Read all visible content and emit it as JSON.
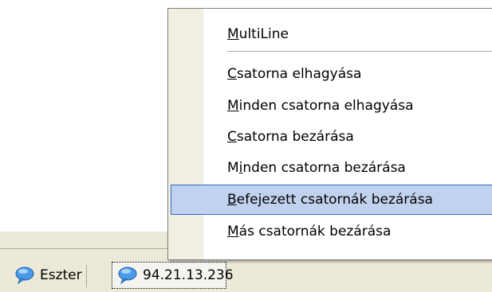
{
  "menu": {
    "items": [
      {
        "mnemonic": "M",
        "rest": "ultiLine"
      },
      {
        "mnemonic": "C",
        "rest": "satorna elhagyása"
      },
      {
        "mnemonic": "M",
        "rest": "inden csatorna elhagyása"
      },
      {
        "mnemonic": "C",
        "rest": "satorna bezárása"
      },
      {
        "pre": "M",
        "mnemonic": "i",
        "rest": "nden csatorna bezárása"
      },
      {
        "mnemonic": "B",
        "rest": "efejezett csatornák bezárása",
        "highlighted": true
      },
      {
        "mnemonic": "M",
        "rest": "ás csatornák bezárása"
      }
    ]
  },
  "tabs": [
    {
      "label": "Eszter",
      "icon": "chat-bubble-icon"
    },
    {
      "label": "94.21.13.236",
      "icon": "chat-bubble-icon",
      "active": true
    }
  ],
  "colors": {
    "highlight_fill": "#c1d2ee",
    "highlight_border": "#316ac5",
    "gutter": "#f1efe2",
    "taskbar": "#ece9d8",
    "chat_icon": "#2f7fd8"
  }
}
